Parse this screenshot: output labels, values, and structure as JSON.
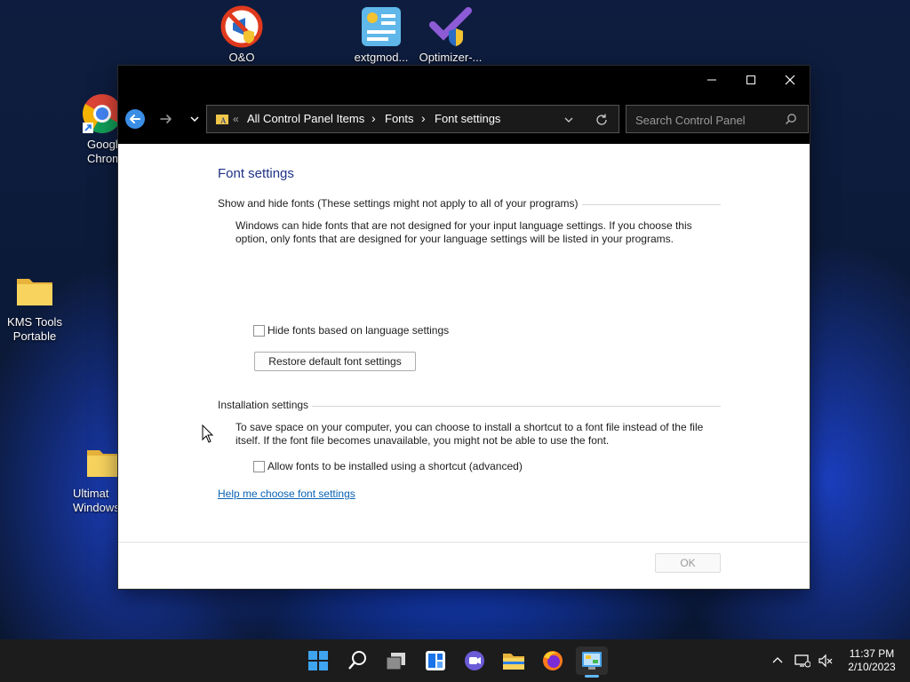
{
  "desktop": {
    "icons": [
      {
        "label": "O&O"
      },
      {
        "label": "extgmod..."
      },
      {
        "label": "Optimizer-..."
      },
      {
        "label": "Google Chrome",
        "visible_label": "Google\nChrom"
      },
      {
        "label": "KMS Tools Portable"
      },
      {
        "label": "Ultimate Windows",
        "visible_label": "Ultimat\nWindows"
      }
    ]
  },
  "window": {
    "caption_buttons": {
      "minimize": "—",
      "maximize": "☐",
      "close": "✕"
    },
    "address": {
      "chevrons": "«",
      "crumbs": [
        "All Control Panel Items",
        "Fonts",
        "Font settings"
      ],
      "separator": "›"
    },
    "search": {
      "placeholder": "Search Control Panel"
    },
    "heading": "Font settings",
    "show_hide": {
      "group_title": "Show and hide fonts (These settings might not apply to all of your programs)",
      "description_line1": "Windows can hide fonts that are not designed for your input language settings. If you choose this",
      "description_line2": "option, only fonts that are designed for your language settings will be listed in your programs.",
      "checkbox_label": "Hide fonts based on language settings",
      "checkbox_checked": false,
      "restore_button": "Restore default font settings"
    },
    "installation": {
      "group_title": "Installation settings",
      "description_line1": "To save space on your computer, you can choose to install a shortcut to a font file instead of the file",
      "description_line2": "itself. If the font file becomes unavailable, you might not be able to use the font.",
      "checkbox_label": "Allow fonts to be installed using a shortcut (advanced)",
      "checkbox_checked": false
    },
    "help_link": "Help me choose font settings",
    "ok_button": "OK"
  },
  "taskbar": {
    "apps": [
      "start",
      "search",
      "task-view",
      "widgets",
      "teams-chat",
      "file-explorer",
      "firefox",
      "control-panel"
    ],
    "clock": {
      "time": "11:37 PM",
      "date": "2/10/2023"
    }
  },
  "colors": {
    "title_bar": "#000000",
    "heading": "#1e3287",
    "link": "#0a63b5",
    "taskbar": "#1c1c1c"
  }
}
